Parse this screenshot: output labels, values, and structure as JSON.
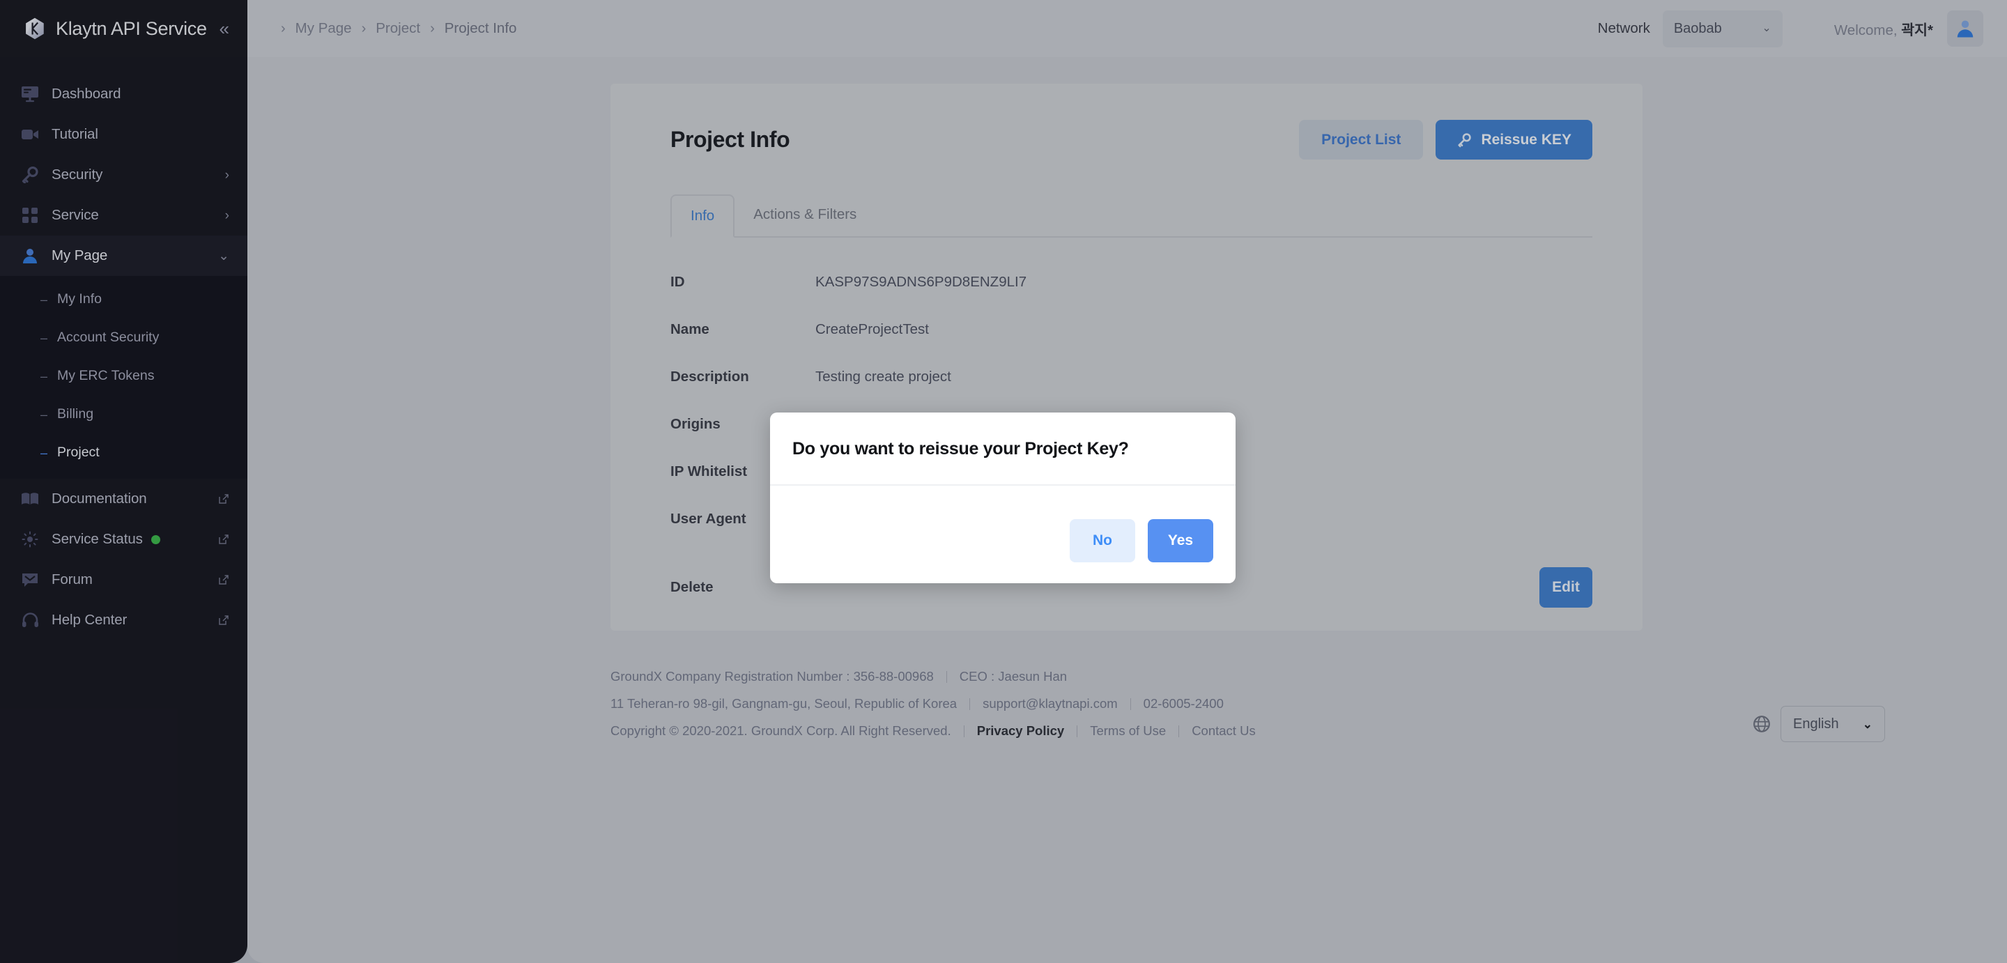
{
  "brand": {
    "title": "Klaytn API Service",
    "collapse_icon": "chevron-double-left-icon"
  },
  "sidebar": {
    "items": [
      {
        "label": "Dashboard",
        "icon": "dashboard-icon",
        "caret": "",
        "external": false
      },
      {
        "label": "Tutorial",
        "icon": "video-icon",
        "caret": "",
        "external": false
      },
      {
        "label": "Security",
        "icon": "key-icon",
        "caret": "›",
        "external": false
      },
      {
        "label": "Service",
        "icon": "grid-icon",
        "caret": "›",
        "external": false
      },
      {
        "label": "My Page",
        "icon": "user-icon",
        "caret": "⌄",
        "external": false
      }
    ],
    "sub_items": [
      {
        "label": "My Info",
        "dash": "–",
        "selected": false
      },
      {
        "label": "Account Security",
        "dash": "–",
        "selected": false
      },
      {
        "label": "My ERC Tokens",
        "dash": "–",
        "selected": false
      },
      {
        "label": "Billing",
        "dash": "–",
        "selected": false
      },
      {
        "label": "Project",
        "dash": "–",
        "selected": true
      }
    ],
    "bottom_items": [
      {
        "label": "Documentation",
        "icon": "book-icon",
        "external": true,
        "status": false
      },
      {
        "label": "Service Status",
        "icon": "sun-icon",
        "external": true,
        "status": true
      },
      {
        "label": "Forum",
        "icon": "chat-icon",
        "external": true,
        "status": false
      },
      {
        "label": "Help Center",
        "icon": "headset-icon",
        "external": true,
        "status": false
      }
    ],
    "status_color": "#3bb54a"
  },
  "topbar": {
    "breadcrumb": [
      "My Page",
      "Project",
      "Project Info"
    ],
    "breadcrumb_sep": "›",
    "network_label": "Network",
    "network_value": "Baobab",
    "network_chevron": "⌄",
    "welcome_prefix": "Welcome, ",
    "welcome_user": "곽지*",
    "avatar_icon": "user-avatar-icon"
  },
  "page": {
    "title": "Project Info",
    "project_list_label": "Project List",
    "reissue_key_label": "Reissue KEY",
    "reissue_key_icon": "key-icon",
    "tabs": [
      {
        "label": "Info",
        "active": true
      },
      {
        "label": "Actions & Filters",
        "active": false
      }
    ],
    "rows": [
      {
        "label": "ID",
        "value": "KASP97S9ADNS6P9D8ENZ9LI7"
      },
      {
        "label": "Name",
        "value": "CreateProjectTest"
      },
      {
        "label": "Description",
        "value": "Testing create project"
      },
      {
        "label": "Origins",
        "value": ""
      },
      {
        "label": "IP Whitelist",
        "value": ""
      },
      {
        "label": "User Agent",
        "value": ""
      }
    ],
    "delete_label": "Delete",
    "edit_label": "Edit",
    "accent_color": "#3f7cc9"
  },
  "modal": {
    "title": "Do you want to reissue your Project Key?",
    "no_label": "No",
    "yes_label": "Yes",
    "no_color": "#3f8ef7",
    "yes_color": "#5791f2"
  },
  "footer": {
    "line1": {
      "registration": "GroundX Company Registration Number : 356-88-00968",
      "ceo": "CEO : Jaesun Han"
    },
    "line2": {
      "address": "11 Teheran-ro 98-gil, Gangnam-gu, Seoul, Republic of Korea",
      "email": "support@klaytnapi.com",
      "phone": "02-6005-2400"
    },
    "line3": {
      "copyright": "Copyright © 2020-2021. GroundX Corp. All Right Reserved.",
      "privacy": "Privacy Policy",
      "terms": "Terms of Use",
      "contact": "Contact Us"
    },
    "language_value": "English",
    "language_chevron": "⌄",
    "globe_icon": "globe-icon"
  }
}
